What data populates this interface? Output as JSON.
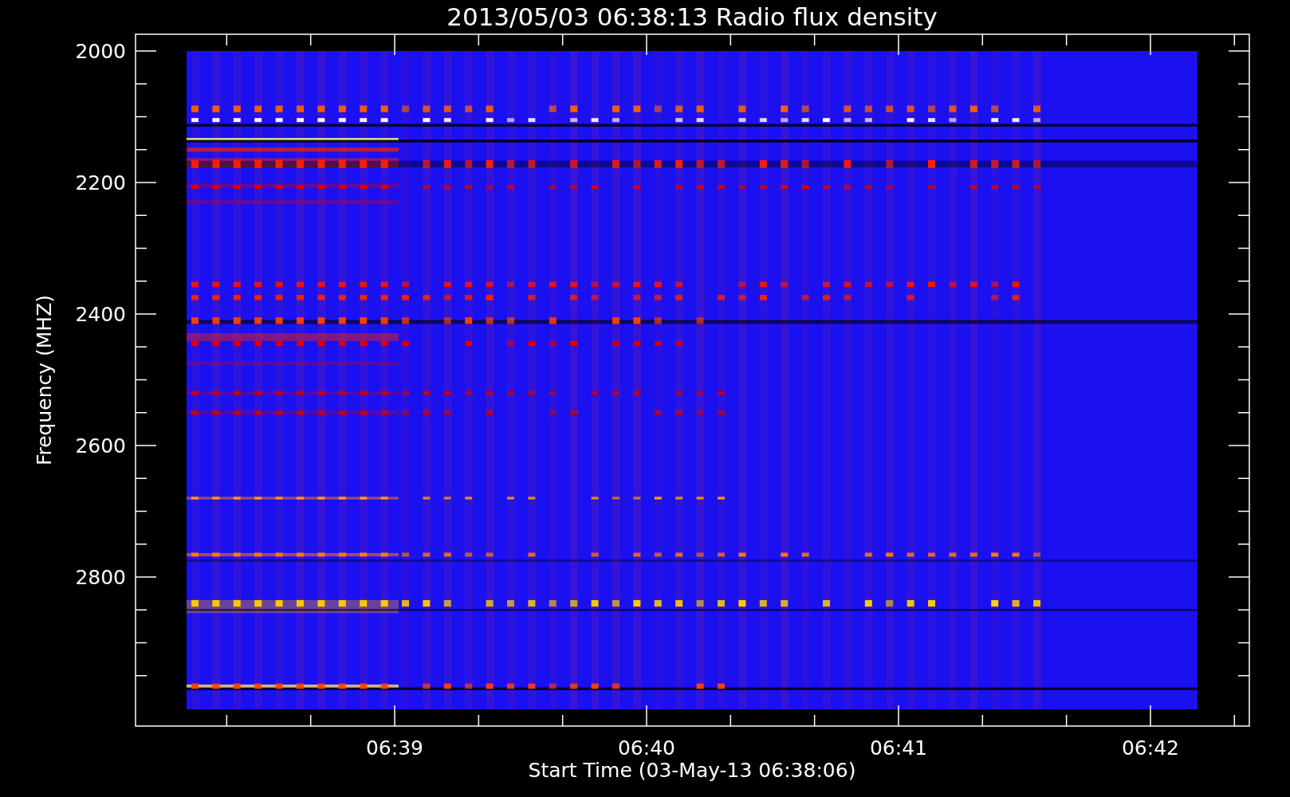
{
  "title": "2013/05/03 06:38:13 Radio flux density",
  "y_axis": {
    "label": "Frequency (MHZ)",
    "ticks": [
      "2000",
      "2200",
      "2400",
      "2600",
      "2800"
    ]
  },
  "x_axis": {
    "label": "Start Time (03-May-13 06:38:06)",
    "ticks": [
      "06:39",
      "06:40",
      "06:41",
      "06:42"
    ]
  }
}
